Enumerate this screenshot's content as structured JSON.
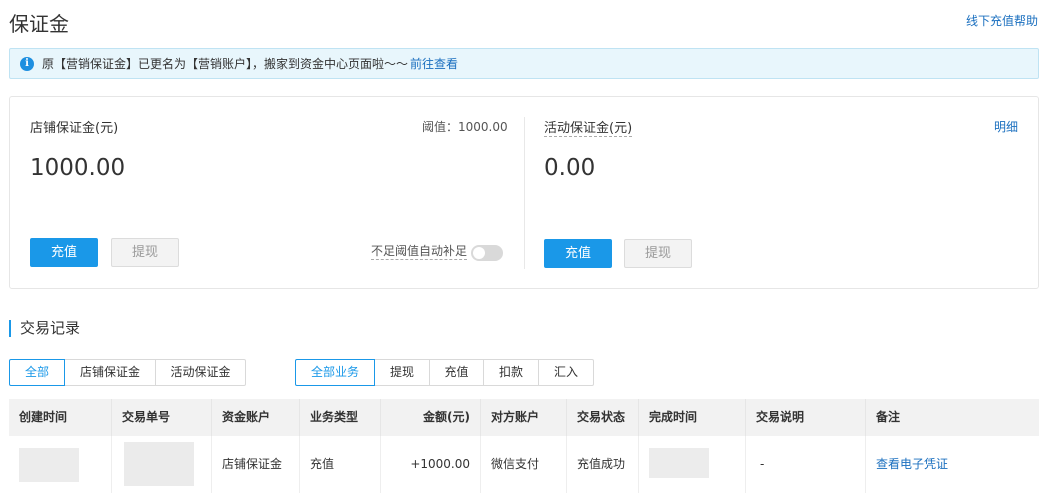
{
  "header": {
    "title": "保证金",
    "help_link": "线下充值帮助"
  },
  "notice": {
    "icon": "info-icon",
    "text": "原【营销保证金】已更名为【营销账户】，搬家到资金中心页面啦～～",
    "link": "前往查看"
  },
  "store_deposit": {
    "label": "店铺保证金(元)",
    "threshold": "阈值：1000.00",
    "amount": "1000.00",
    "recharge": "充值",
    "withdraw": "提现",
    "auto_topup_label": "不足阈值自动补足",
    "auto_topup_on": false
  },
  "activity_deposit": {
    "label": "活动保证金(元)",
    "detail": "明细",
    "amount": "0.00",
    "recharge": "充值",
    "withdraw": "提现"
  },
  "records": {
    "title": "交易记录",
    "account_tabs": [
      "全部",
      "店铺保证金",
      "活动保证金"
    ],
    "account_active": 0,
    "type_tabs": [
      "全部业务",
      "提现",
      "充值",
      "扣款",
      "汇入"
    ],
    "type_active": 0,
    "columns": [
      "创建时间",
      "交易单号",
      "资金账户",
      "业务类型",
      "金额(元)",
      "对方账户",
      "交易状态",
      "完成时间",
      "交易说明",
      "备注"
    ],
    "rows": [
      {
        "account": "店铺保证金",
        "type": "充值",
        "amount": "+1000.00",
        "counterparty": "微信支付",
        "status": "充值成功",
        "description": "-",
        "remark": "查看电子凭证"
      }
    ]
  },
  "colors": {
    "accent": "#1a98e8",
    "link": "#1a6fbf",
    "notice_bg": "#e8f6fc"
  }
}
